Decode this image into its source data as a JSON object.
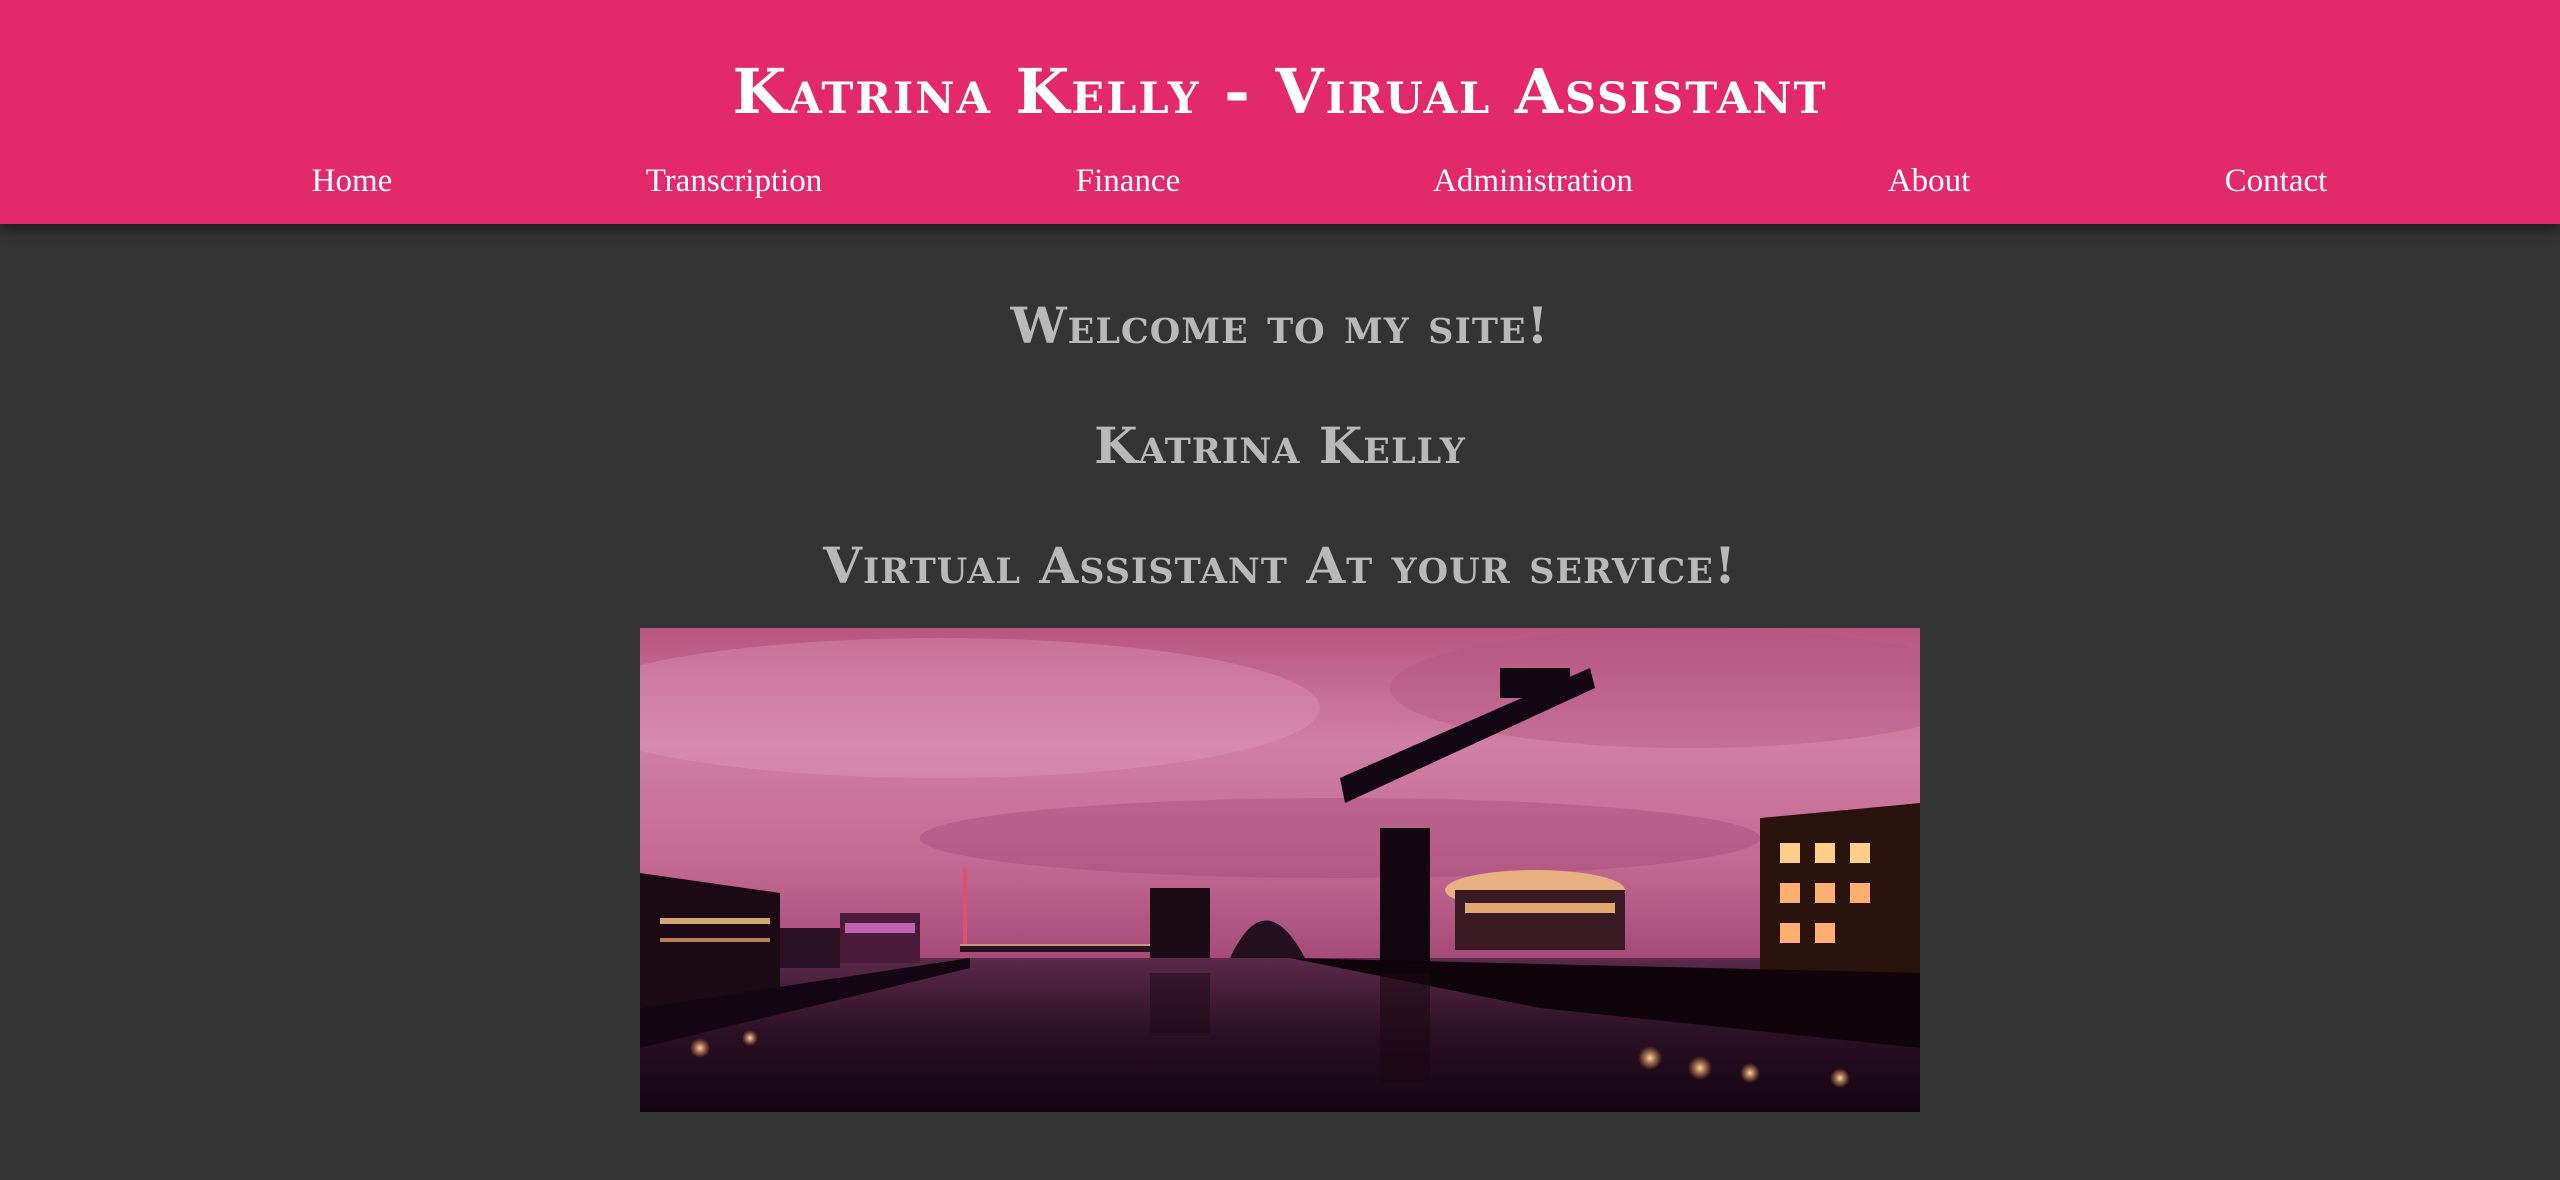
{
  "header": {
    "title": "Katrina Kelly - Virual Assistant",
    "nav": [
      {
        "label": "Home"
      },
      {
        "label": "Transcription"
      },
      {
        "label": "Finance"
      },
      {
        "label": "Administration"
      },
      {
        "label": "About"
      },
      {
        "label": "Contact"
      }
    ]
  },
  "main": {
    "welcome": "Welcome to my site!",
    "name": "Katrina Kelly",
    "tagline": "Virtual Assistant At your service!",
    "hero_image_icon": "city-skyline-photo"
  },
  "colors": {
    "header_bg": "#e4296b",
    "page_bg": "#333333",
    "heading_text": "#b9b9b9",
    "nav_text": "#ffffff"
  }
}
